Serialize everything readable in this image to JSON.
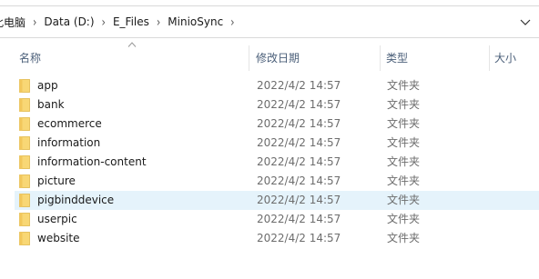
{
  "address_bar": {
    "breadcrumbs": [
      "此电脑",
      "Data (D:)",
      "E_Files",
      "MinioSync"
    ],
    "dropdown_icon": "chevron-down-icon"
  },
  "columns": {
    "name": "名称",
    "date": "修改日期",
    "type": "类型",
    "size": "大小"
  },
  "files": [
    {
      "name": "app",
      "date": "2022/4/2 14:57",
      "type": "文件夹"
    },
    {
      "name": "bank",
      "date": "2022/4/2 14:57",
      "type": "文件夹"
    },
    {
      "name": "ecommerce",
      "date": "2022/4/2 14:57",
      "type": "文件夹"
    },
    {
      "name": "information",
      "date": "2022/4/2 14:57",
      "type": "文件夹"
    },
    {
      "name": "information-content",
      "date": "2022/4/2 14:57",
      "type": "文件夹"
    },
    {
      "name": "picture",
      "date": "2022/4/2 14:57",
      "type": "文件夹"
    },
    {
      "name": "pigbinddevice",
      "date": "2022/4/2 14:57",
      "type": "文件夹"
    },
    {
      "name": "userpic",
      "date": "2022/4/2 14:57",
      "type": "文件夹"
    },
    {
      "name": "website",
      "date": "2022/4/2 14:57",
      "type": "文件夹"
    }
  ],
  "colors": {
    "folder": "#f8d775",
    "hover_row": "#e5f3fb",
    "header_text": "#4c607a"
  }
}
